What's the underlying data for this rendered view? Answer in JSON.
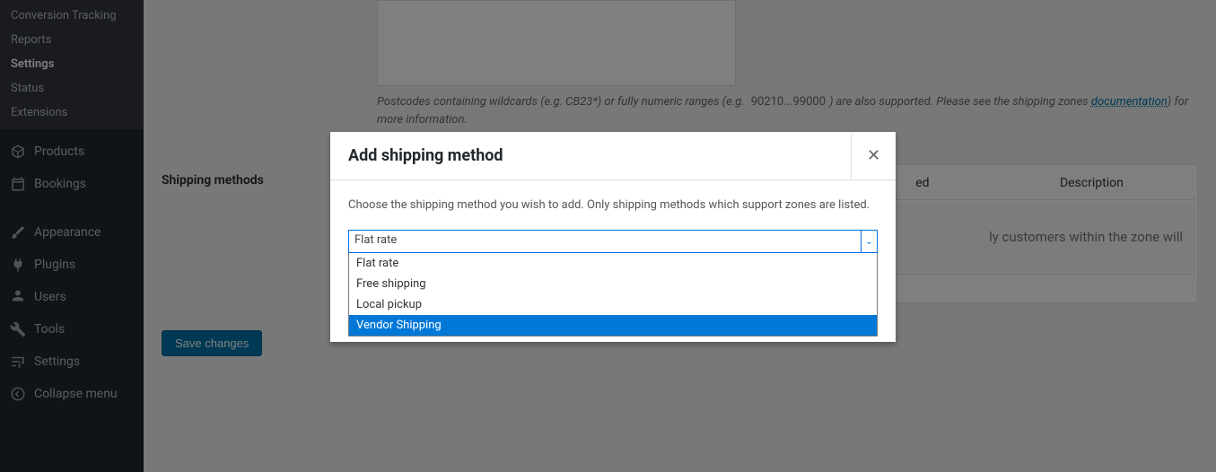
{
  "sidebar": {
    "sub": [
      {
        "label": "Conversion Tracking",
        "current": false
      },
      {
        "label": "Reports",
        "current": false
      },
      {
        "label": "Settings",
        "current": true
      },
      {
        "label": "Status",
        "current": false
      },
      {
        "label": "Extensions",
        "current": false
      }
    ],
    "top": [
      {
        "label": "Products",
        "icon": "cube-icon"
      },
      {
        "label": "Bookings",
        "icon": "calendar-icon"
      },
      {
        "label": "Appearance",
        "icon": "brush-icon"
      },
      {
        "label": "Plugins",
        "icon": "plug-icon"
      },
      {
        "label": "Users",
        "icon": "user-icon"
      },
      {
        "label": "Tools",
        "icon": "wrench-icon"
      },
      {
        "label": "Settings",
        "icon": "sliders-icon"
      },
      {
        "label": "Collapse menu",
        "icon": "collapse-icon"
      }
    ]
  },
  "page": {
    "postcode_hint_pre": "Postcodes containing wildcards (e.g. CB23*) or fully numeric ranges (e.g. ",
    "postcode_hint_code": "90210...99000",
    "postcode_hint_mid": ") are also supported. Please see the shipping zones ",
    "postcode_hint_link": "documentation",
    "postcode_hint_post": ") for more information.",
    "shipping_label": "Shipping methods",
    "table_head_enabled": "ed",
    "table_head_desc": "Description",
    "placeholder_text": "ly customers within the zone will",
    "save_label": "Save changes"
  },
  "modal": {
    "title": "Add shipping method",
    "desc": "Choose the shipping method you wish to add. Only shipping methods which support zones are listed.",
    "selected": "Flat rate",
    "options": [
      "Flat rate",
      "Free shipping",
      "Local pickup",
      "Vendor Shipping"
    ],
    "highlight_index": 3
  }
}
